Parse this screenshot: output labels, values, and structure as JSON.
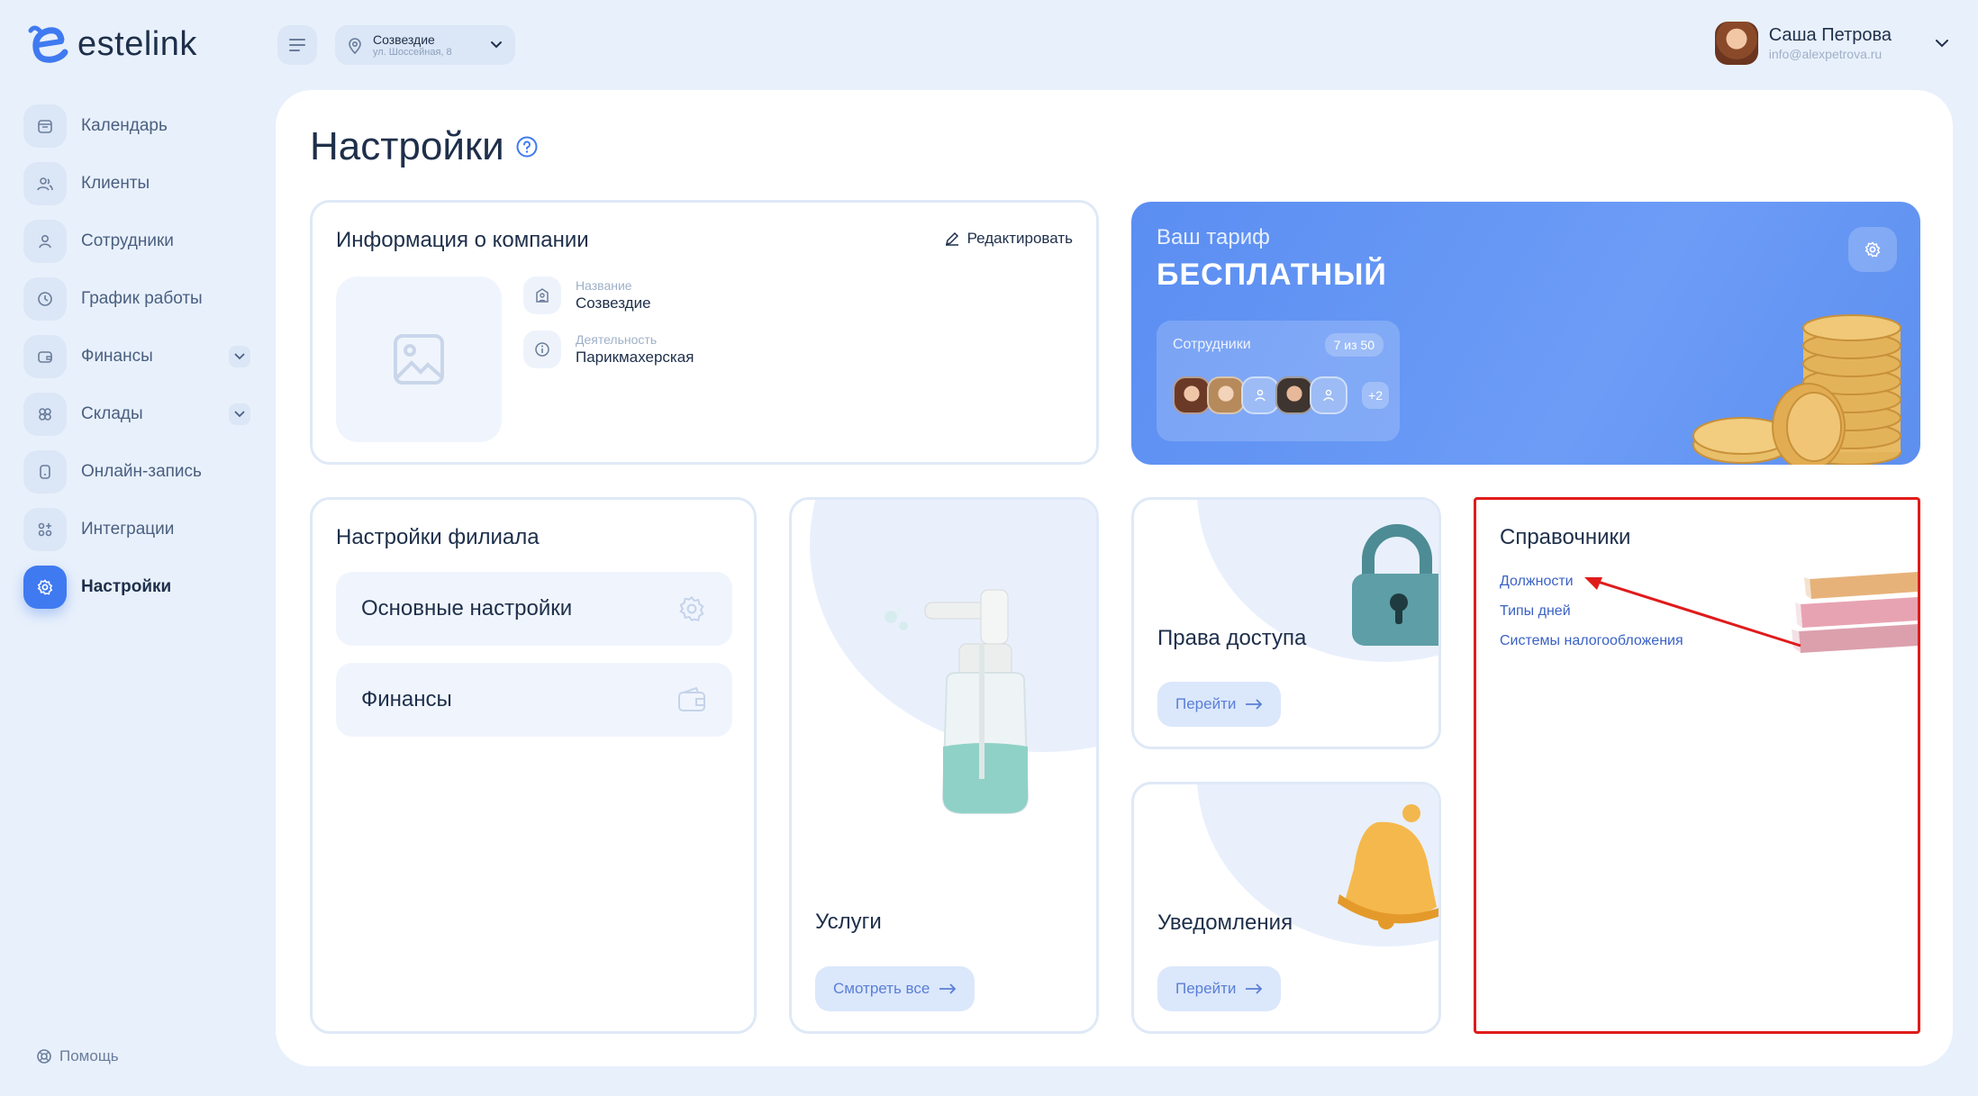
{
  "app": {
    "logo_text": "estelink"
  },
  "header": {
    "branch_name": "Созвездие",
    "branch_address": "ул. Шоссейная, 8",
    "user_name": "Саша Петрова",
    "user_email": "info@alexpetrova.ru"
  },
  "sidebar": {
    "items": [
      {
        "label": "Календарь",
        "icon": "calendar-icon"
      },
      {
        "label": "Клиенты",
        "icon": "clients-icon"
      },
      {
        "label": "Сотрудники",
        "icon": "employee-icon"
      },
      {
        "label": "График работы",
        "icon": "clock-icon"
      },
      {
        "label": "Финансы",
        "icon": "wallet-icon"
      },
      {
        "label": "Склады",
        "icon": "boxes-icon"
      },
      {
        "label": "Онлайн-запись",
        "icon": "phone-icon"
      },
      {
        "label": "Интеграции",
        "icon": "integrations-icon"
      },
      {
        "label": "Настройки",
        "icon": "settings-icon"
      }
    ],
    "active_index": 8,
    "help_label": "Помощь"
  },
  "page": {
    "title": "Настройки"
  },
  "company": {
    "title": "Информация о компании",
    "edit_label": "Редактировать",
    "name_key": "Название",
    "name_value": "Созвездие",
    "activity_key": "Деятельность",
    "activity_value": "Парикмахерская"
  },
  "tariff": {
    "label": "Ваш тариф",
    "plan": "БЕСПЛАТНЫЙ",
    "staff_label": "Сотрудники",
    "staff_count": "7 из 50",
    "more_count": "+2"
  },
  "branch_settings": {
    "title": "Настройки филиала",
    "buttons": [
      "Основные настройки",
      "Финансы"
    ]
  },
  "services": {
    "title": "Услуги",
    "button": "Смотреть все"
  },
  "access": {
    "title": "Права доступа",
    "button": "Перейти"
  },
  "notifications": {
    "title": "Уведомления",
    "button": "Перейти"
  },
  "directories": {
    "title": "Справочники",
    "links": [
      "Должности",
      "Типы дней",
      "Системы налогообложения"
    ]
  },
  "colors": {
    "accent": "#3f7af0",
    "highlight_box": "#e01b1b",
    "annotation_arrow": "#e01b1b"
  }
}
